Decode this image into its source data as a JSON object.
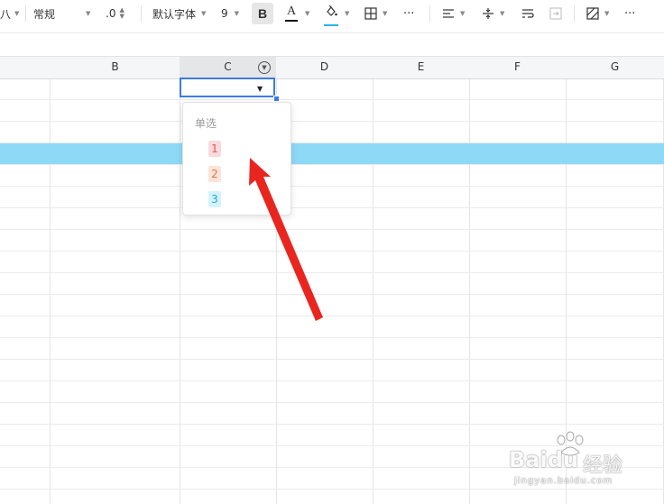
{
  "toolbar": {
    "partial_label": "八",
    "number_format": "常规",
    "decimal": ".0",
    "font_name": "默认字体",
    "font_size": "9",
    "bold": "B",
    "font_color_letter": "A",
    "more": "···",
    "more2": "···"
  },
  "columns": [
    "B",
    "C",
    "D",
    "E",
    "F",
    "G"
  ],
  "dropdown": {
    "title": "单选",
    "options": [
      {
        "label": "1",
        "bg": "#fadadd",
        "fg": "#e05a5a"
      },
      {
        "label": "2",
        "bg": "#fde3d8",
        "fg": "#e0754b"
      },
      {
        "label": "3",
        "bg": "#d4f2fb",
        "fg": "#1ea9d6"
      }
    ]
  },
  "colors": {
    "selection": "#3c7be4",
    "row_highlight": "#8ed9f6",
    "annotation_arrow": "#e8261f"
  },
  "watermark": {
    "brand": "Baidu",
    "cn": "经验",
    "url": "jingyan.baidu.com"
  }
}
